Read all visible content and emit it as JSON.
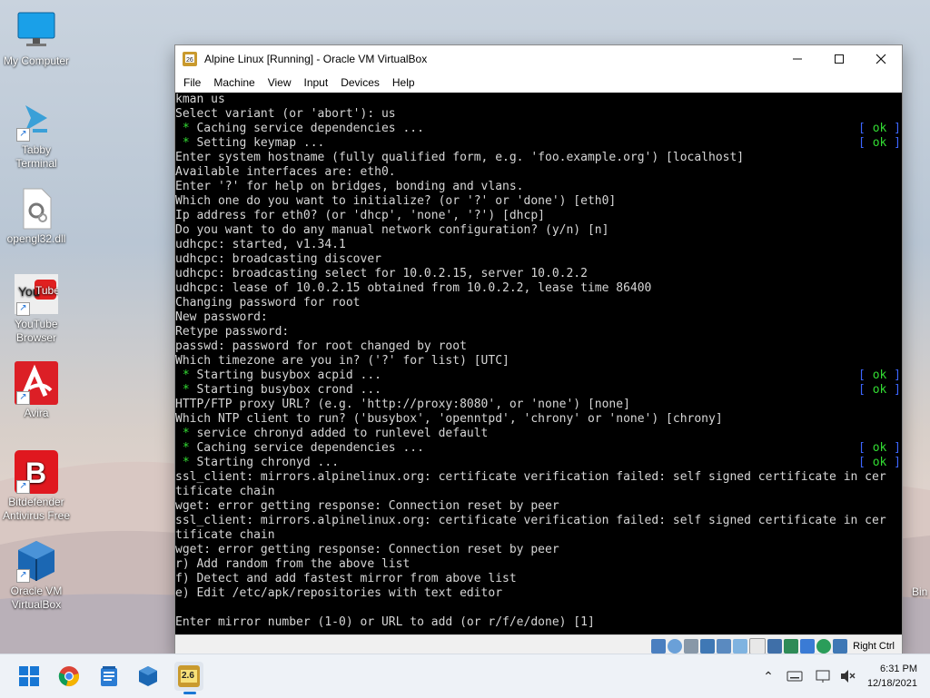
{
  "desktop": {
    "icons": [
      {
        "label": "My Computer"
      },
      {
        "label": "Tabby Terminal"
      },
      {
        "label": "opengl32.dll"
      },
      {
        "label": "YouTube Browser"
      },
      {
        "label": "Avira"
      },
      {
        "label": "Bitdefender Antivirus Free"
      },
      {
        "label": "Oracle VM VirtualBox"
      }
    ],
    "edge_text": "Bin"
  },
  "window": {
    "title": "Alpine Linux [Running] - Oracle VM VirtualBox",
    "menu": [
      "File",
      "Machine",
      "View",
      "Input",
      "Devices",
      "Help"
    ],
    "terminal_lines": [
      {
        "text": "kman us",
        "ok": ""
      },
      {
        "text": "Select variant (or 'abort'): us",
        "ok": ""
      },
      {
        "text": " * Caching service dependencies ...",
        "ok": "ok"
      },
      {
        "text": " * Setting keymap ...",
        "ok": "ok"
      },
      {
        "text": "Enter system hostname (fully qualified form, e.g. 'foo.example.org') [localhost]",
        "ok": ""
      },
      {
        "text": "Available interfaces are: eth0.",
        "ok": ""
      },
      {
        "text": "Enter '?' for help on bridges, bonding and vlans.",
        "ok": ""
      },
      {
        "text": "Which one do you want to initialize? (or '?' or 'done') [eth0]",
        "ok": ""
      },
      {
        "text": "Ip address for eth0? (or 'dhcp', 'none', '?') [dhcp]",
        "ok": ""
      },
      {
        "text": "Do you want to do any manual network configuration? (y/n) [n]",
        "ok": ""
      },
      {
        "text": "udhcpc: started, v1.34.1",
        "ok": ""
      },
      {
        "text": "udhcpc: broadcasting discover",
        "ok": ""
      },
      {
        "text": "udhcpc: broadcasting select for 10.0.2.15, server 10.0.2.2",
        "ok": ""
      },
      {
        "text": "udhcpc: lease of 10.0.2.15 obtained from 10.0.2.2, lease time 86400",
        "ok": ""
      },
      {
        "text": "Changing password for root",
        "ok": ""
      },
      {
        "text": "New password:",
        "ok": ""
      },
      {
        "text": "Retype password:",
        "ok": ""
      },
      {
        "text": "passwd: password for root changed by root",
        "ok": ""
      },
      {
        "text": "Which timezone are you in? ('?' for list) [UTC]",
        "ok": ""
      },
      {
        "text": " * Starting busybox acpid ...",
        "ok": "ok"
      },
      {
        "text": " * Starting busybox crond ...",
        "ok": "ok"
      },
      {
        "text": "HTTP/FTP proxy URL? (e.g. 'http://proxy:8080', or 'none') [none]",
        "ok": ""
      },
      {
        "text": "Which NTP client to run? ('busybox', 'openntpd', 'chrony' or 'none') [chrony]",
        "ok": ""
      },
      {
        "text": " * service chronyd added to runlevel default",
        "ok": ""
      },
      {
        "text": " * Caching service dependencies ...",
        "ok": "ok"
      },
      {
        "text": " * Starting chronyd ...",
        "ok": "ok"
      },
      {
        "text": "ssl_client: mirrors.alpinelinux.org: certificate verification failed: self signed certificate in cer",
        "ok": ""
      },
      {
        "text": "tificate chain",
        "ok": ""
      },
      {
        "text": "wget: error getting response: Connection reset by peer",
        "ok": ""
      },
      {
        "text": "ssl_client: mirrors.alpinelinux.org: certificate verification failed: self signed certificate in cer",
        "ok": ""
      },
      {
        "text": "tificate chain",
        "ok": ""
      },
      {
        "text": "wget: error getting response: Connection reset by peer",
        "ok": ""
      },
      {
        "text": "r) Add random from the above list",
        "ok": ""
      },
      {
        "text": "f) Detect and add fastest mirror from above list",
        "ok": ""
      },
      {
        "text": "e) Edit /etc/apk/repositories with text editor",
        "ok": ""
      },
      {
        "text": "",
        "ok": ""
      },
      {
        "text": "Enter mirror number (1-0) or URL to add (or r/f/e/done) [1]",
        "ok": ""
      }
    ],
    "ok_open": "[ ",
    "ok_close": " ]",
    "host_key": "Right Ctrl"
  },
  "taskbar": {
    "time": "6:31 PM",
    "date": "12/18/2021",
    "tabby_badge": "2.6"
  },
  "colors": {
    "terminal_bg": "#000000",
    "terminal_fg": "#d6d6d6",
    "star_green": "#33dd33",
    "bracket_blue": "#3c66ff"
  }
}
